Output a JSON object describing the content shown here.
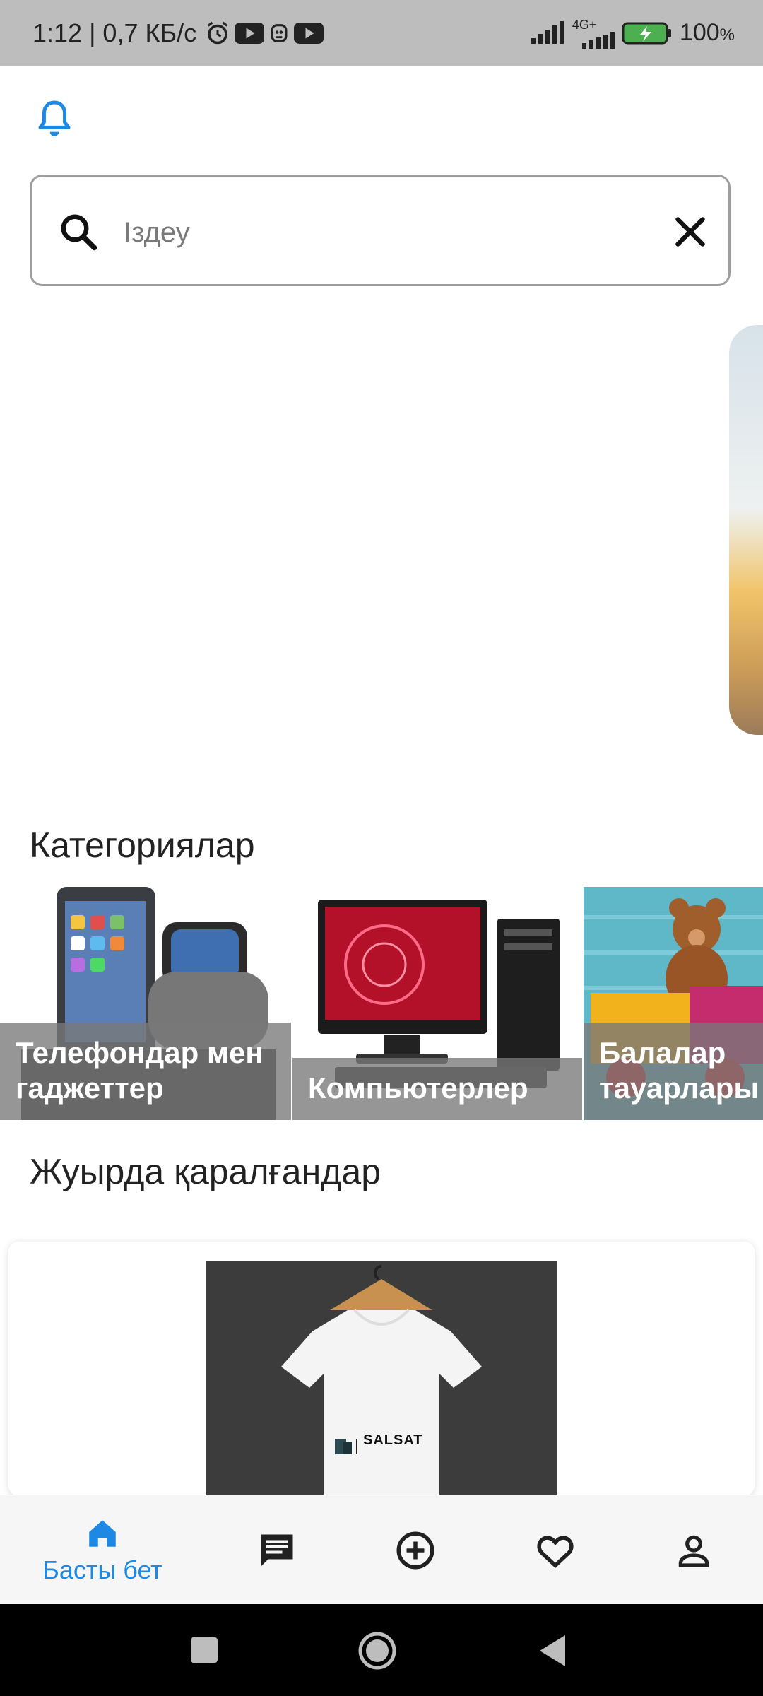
{
  "status_bar": {
    "time_speed": "1:12 | 0,7 КБ/с",
    "network": "4G+",
    "battery_percent": "100",
    "battery_unit": "%"
  },
  "search": {
    "placeholder": "Іздеу",
    "value": ""
  },
  "categories": {
    "title": "Категориялар",
    "items": [
      {
        "label": "Телефондар мен гаджеттер"
      },
      {
        "label": "Компьютерлер"
      },
      {
        "label": "Балалар тауарлары"
      }
    ]
  },
  "recent": {
    "title": "Жуырда қаралғандар",
    "product_brand": "SALSAT"
  },
  "bottom_nav": {
    "home_label": "Басты бет"
  },
  "colors": {
    "accent": "#1e88e5",
    "status_bar": "#bdbdbd"
  }
}
